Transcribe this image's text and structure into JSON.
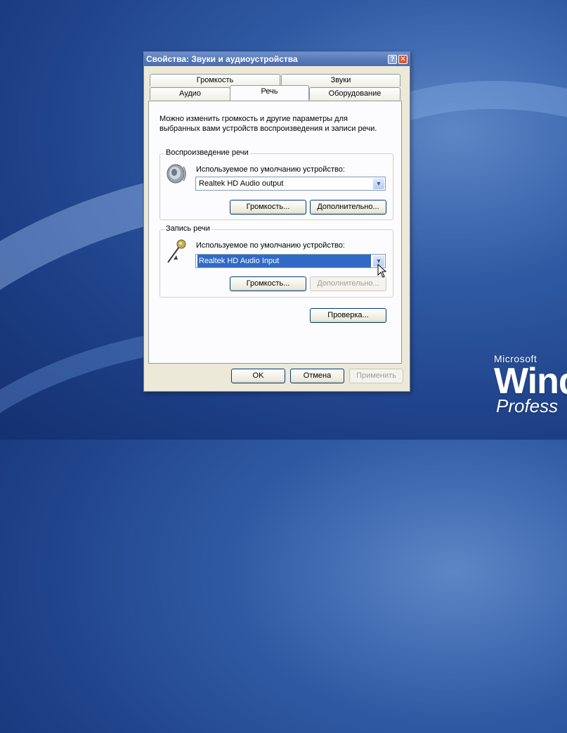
{
  "window": {
    "title": "Свойства: Звуки и аудиоустройства",
    "help_btn": "?",
    "close_btn": "✕"
  },
  "tabs": {
    "top_row": [
      "Громкость",
      "Звуки"
    ],
    "bottom_row": [
      "Аудио",
      "Речь",
      "Оборудование"
    ],
    "active": "Речь"
  },
  "panel": {
    "description_line1": "Можно изменить громкость и другие параметры для",
    "description_line2": "выбранных вами устройств воспроизведения и записи речи.",
    "playback": {
      "legend": "Воспроизведение речи",
      "device_label": "Используемое по умолчанию устройство:",
      "device_value": "Realtek HD Audio output",
      "volume_button": "Громкость...",
      "advanced_button": "Дополнительно..."
    },
    "recording": {
      "legend": "Запись речи",
      "device_label": "Используемое по умолчанию устройство:",
      "device_value": "Realtek HD Audio Input",
      "volume_button": "Громкость...",
      "advanced_button": "Дополнительно..."
    },
    "test_button": "Проверка..."
  },
  "footer": {
    "ok": "OK",
    "cancel": "Отмена",
    "apply": "Применить"
  },
  "desktop": {
    "brand_small": "Microsoft",
    "brand_large": "Wind",
    "brand_edition": "Profess"
  },
  "icons": {
    "playback": "speaker-icon",
    "recording": "microphone-icon",
    "dropdown": "chevron-down-icon"
  },
  "colors": {
    "titlebar": "#5677b8",
    "selection": "#316ac5",
    "dialog_bg": "#ece9d8"
  }
}
